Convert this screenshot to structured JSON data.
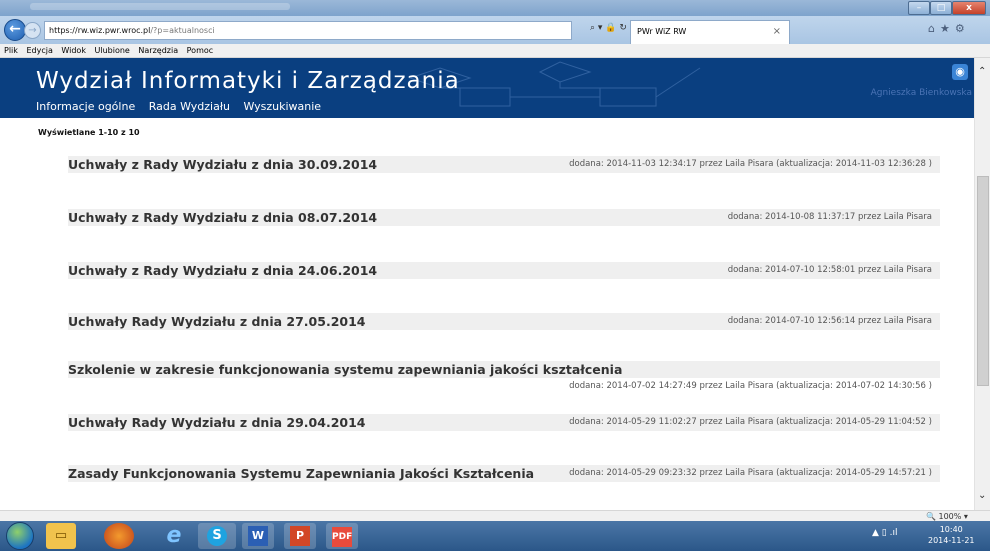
{
  "browser": {
    "address_prefix": "https://",
    "address_host": "rw.wiz.pwr.wroc.pl",
    "address_path": "/?p=aktualnosci",
    "address_icons": "⌕ ▾ 🔒 ↻",
    "tab_title": "PWr WiZ RW",
    "tab_close": "×",
    "right_icons": "⌂★⚙",
    "win_min": "–",
    "win_max": "□",
    "win_close": "x"
  },
  "menubar": {
    "items": [
      "Plik",
      "Edycja",
      "Widok",
      "Ulubione",
      "Narzędzia",
      "Pomoc"
    ]
  },
  "header": {
    "title": "Wydział Informatyki i Zarządzania",
    "nav": [
      "Informacje ogólne",
      "Rada Wydziału",
      "Wyszukiwanie"
    ],
    "user": "Agnieszka Bienkowska",
    "colors": {
      "header_bg": "#0a3f80",
      "user_name": "#4a73b4"
    }
  },
  "listing": {
    "count_label": "Wyświetlane 1-10 z 10",
    "entries": [
      {
        "title": "Uchwały z Rady Wydziału z dnia 30.09.2014",
        "meta": "dodana: 2014-11-03 12:34:17 przez Laila Pisara (aktualizacja: 2014-11-03 12:36:28 )"
      },
      {
        "title": "Uchwały z Rady Wydziału z dnia 08.07.2014",
        "meta": "dodana: 2014-10-08 11:37:17 przez Laila Pisara"
      },
      {
        "title": "Uchwały z Rady Wydziału z dnia 24.06.2014",
        "meta": "dodana: 2014-07-10 12:58:01 przez Laila Pisara"
      },
      {
        "title": "Uchwały Rady Wydziału z dnia 27.05.2014",
        "meta": "dodana: 2014-07-10 12:56:14 przez Laila Pisara"
      },
      {
        "title": "Szkolenie w zakresie funkcjonowania systemu zapewniania jakości kształcenia",
        "meta": "dodana: 2014-07-02 14:27:49 przez Laila Pisara (aktualizacja: 2014-07-02 14:30:56 )"
      },
      {
        "title": "Uchwały Rady Wydziału z dnia 29.04.2014",
        "meta": "dodana: 2014-05-29 11:02:27 przez Laila Pisara (aktualizacja: 2014-05-29 11:04:52 )"
      },
      {
        "title": "Zasady Funkcjonowania Systemu Zapewniania Jakości Kształcenia",
        "meta": "dodana: 2014-05-29 09:23:32 przez Laila Pisara (aktualizacja: 2014-05-29 14:57:21 )"
      }
    ]
  },
  "statusbar": {
    "zoom": "🔍 100% ▾"
  },
  "taskbar": {
    "word": "W",
    "powerpoint": "P",
    "pdf": "PDF",
    "skype": "S",
    "ie": "e",
    "tray": "▲ ▯ .ıl",
    "time": "10:40",
    "date": "2014-11-21"
  }
}
